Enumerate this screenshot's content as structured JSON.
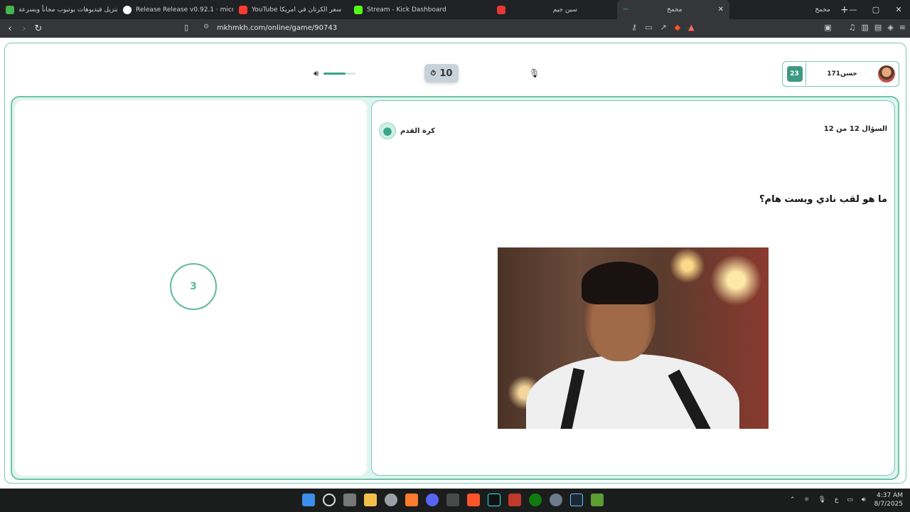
{
  "browser": {
    "tabs": [
      {
        "label": "تنزيل فيديوهات يوتيوب مجاناً وبسرعة",
        "color": "#44b54a"
      },
      {
        "label": "Release Release v0.92.1 · microsoft/P",
        "color": "#ffffff"
      },
      {
        "label": "YouTube سعر الكرتان في امريكا",
        "color": "#ff3b30"
      },
      {
        "label": "Stream - Kick Dashboard",
        "color": "#53fc18"
      },
      {
        "label": "",
        "color": "#e53935"
      },
      {
        "label": "سين جيم",
        "color": "#35363a"
      },
      {
        "label": "مخمخ",
        "color": "#2bb58b",
        "active": true
      },
      {
        "label": "مخمخ",
        "color": "#202124"
      }
    ],
    "url": "mkhmkh.com/online/game/90743",
    "window_controls": {
      "minimize": "—",
      "maximize": "▢",
      "close": "✕"
    }
  },
  "game": {
    "timer": "10",
    "volume_level": 0.7,
    "player": {
      "name": "حسن171",
      "score": "23"
    },
    "countdown": "3",
    "question_counter": "السؤال 12 من 12",
    "category": "كرة القدم",
    "question": "ما هو لقب نادي ويست هام؟"
  },
  "taskbar": {
    "time": "4:37 AM",
    "date": "8/7/2025",
    "lang": "ع"
  }
}
